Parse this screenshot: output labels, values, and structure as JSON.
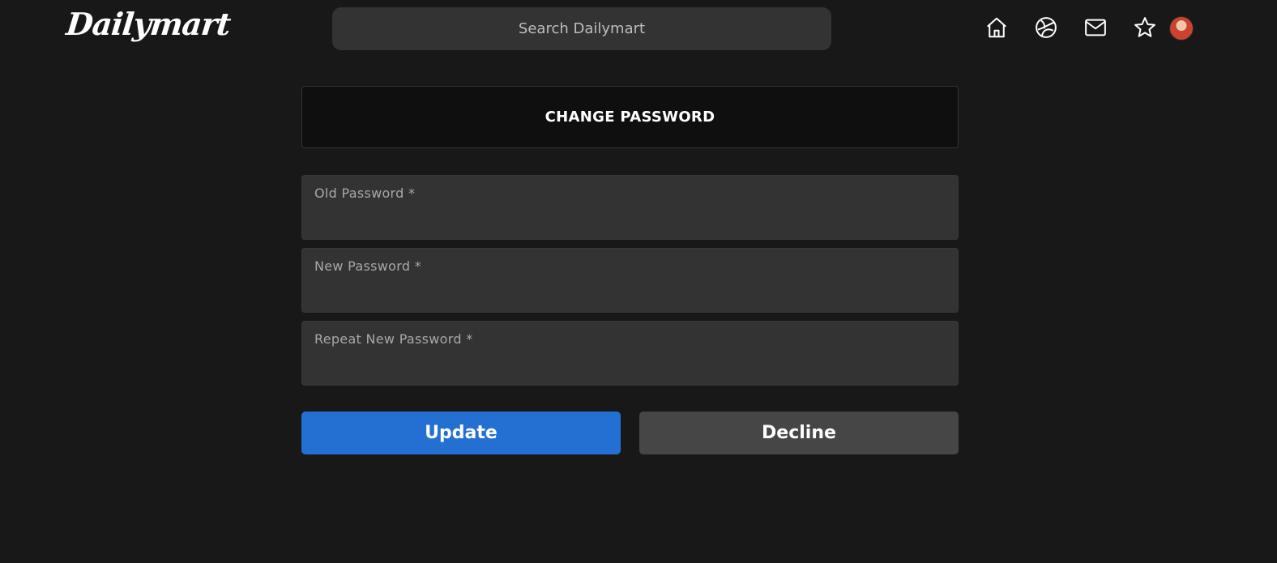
{
  "brand": {
    "name": "Dailymart"
  },
  "search": {
    "placeholder": "Search Dailymart"
  },
  "nav": {
    "icons": [
      "home-icon",
      "globe-icon",
      "mail-icon",
      "star-icon",
      "avatar"
    ]
  },
  "form": {
    "title": "CHANGE PASSWORD",
    "fields": [
      {
        "label": "Old Password *",
        "value": ""
      },
      {
        "label": "New Password *",
        "value": ""
      },
      {
        "label": "Repeat New Password *",
        "value": ""
      }
    ],
    "update_label": "Update",
    "decline_label": "Decline"
  },
  "colors": {
    "background": "#181818",
    "accent": "#236fd2",
    "secondary_button": "#464646",
    "field_bg": "#333333"
  }
}
